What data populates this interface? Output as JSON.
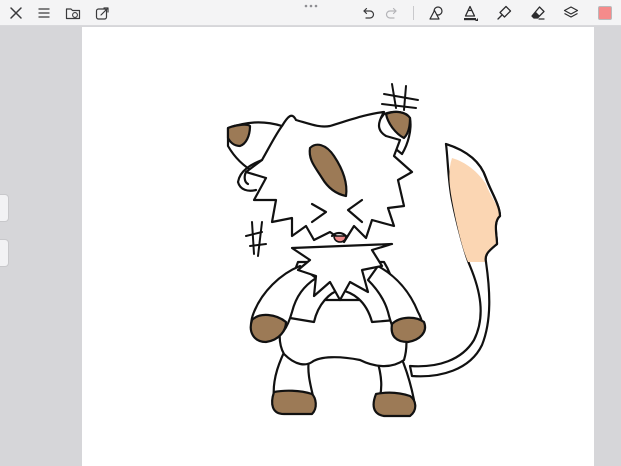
{
  "icons": {
    "close": "close-icon",
    "menu": "menu-icon",
    "gallery": "folder-gallery-icon",
    "share": "share-icon",
    "undo": "undo-icon",
    "redo": "redo-icon",
    "shapes": "shapes-icon",
    "pencil": "pencil-brush-icon",
    "smudge": "smudge-icon",
    "eraser": "eraser-icon",
    "layers": "layers-icon"
  },
  "colors": {
    "current_color": "#f58b8b",
    "ink": "#000000",
    "tan": "#9c7a56",
    "tail": "#fbd6b3",
    "tongue": "#f08a8a"
  }
}
